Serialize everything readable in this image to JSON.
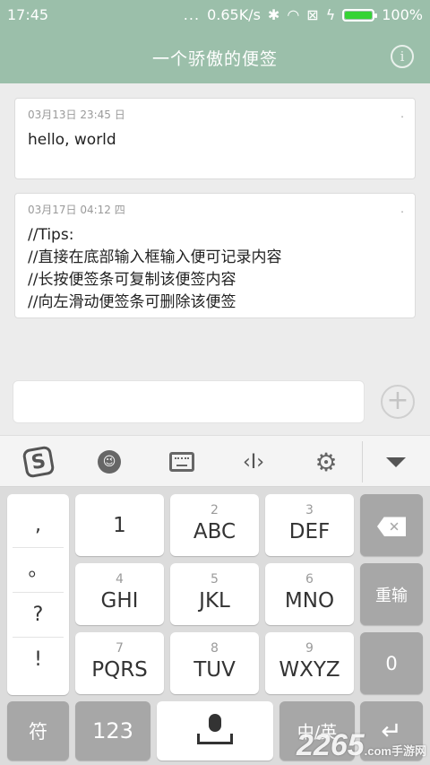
{
  "status": {
    "time": "17:45",
    "dots": "...",
    "speed": "0.65K/s",
    "battery": "100%",
    "battery_level": 1.0
  },
  "header": {
    "title": "一个骄傲的便签",
    "info_glyph": "i"
  },
  "notes": [
    {
      "meta": "03月13日 23:45 日",
      "dot": ".",
      "text": "hello, world"
    },
    {
      "meta": "03月17日 04:12 四",
      "dot": ".",
      "text": "//Tips:\n//直接在底部输入框输入便可记录内容\n//长按便签条可复制该便签内容\n//向左滑动便签条可删除该便签"
    }
  ],
  "input": {
    "value": "",
    "add_glyph": "+"
  },
  "toolbar": {
    "icons": [
      "sogou-logo-icon",
      "emoji-icon",
      "keyboard-icon",
      "cursor-icon",
      "gear-icon",
      "collapse-icon"
    ],
    "sogou_glyph": "S",
    "emoji_glyph": "😉"
  },
  "keyboard": {
    "punct": [
      ",",
      "。",
      "?",
      "!"
    ],
    "keys": [
      {
        "sub": "",
        "main": "1"
      },
      {
        "sub": "2",
        "main": "ABC"
      },
      {
        "sub": "3",
        "main": "DEF"
      },
      {
        "sub": "4",
        "main": "GHI"
      },
      {
        "sub": "5",
        "main": "JKL"
      },
      {
        "sub": "6",
        "main": "MNO"
      },
      {
        "sub": "7",
        "main": "PQRS"
      },
      {
        "sub": "8",
        "main": "TUV"
      },
      {
        "sub": "9",
        "main": "WXYZ"
      }
    ],
    "backspace_glyph": "✕",
    "reenter": "重输",
    "zero": "0",
    "symbols": "符",
    "numbers": "123",
    "lang": "中/英",
    "enter_glyph": "↵"
  },
  "watermark": {
    "text": "2265",
    "suffix": ".com",
    "sub": "手游网"
  }
}
